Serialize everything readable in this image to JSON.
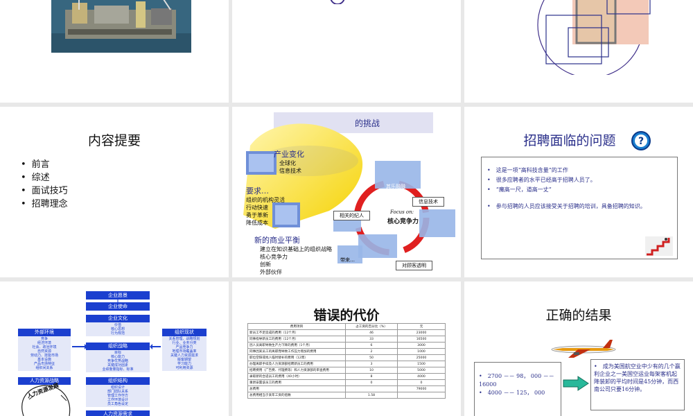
{
  "s2": {
    "title": "内容提要",
    "items": [
      "前言",
      "综述",
      "面试技巧",
      "招聘理念"
    ]
  },
  "s3": {
    "header": "的挑战",
    "h1": "产业变化",
    "l1": [
      "全球化",
      "信息技术"
    ],
    "h2": "要求…",
    "l2": [
      "组织的机构灵活",
      "行动快速",
      "勇于革新",
      "降低成本"
    ],
    "h3": "新的商业平衡",
    "l3": [
      "建立在知识基础上的组织战略",
      "核心竞争力",
      "创新",
      "外部伙伴"
    ],
    "focus_label": "Focus on:",
    "focus_text": "核心竞争力",
    "nodes": [
      "相关的纪人",
      "信息技术",
      "其乐融融",
      "带来…",
      "对顾客透明"
    ]
  },
  "s4": {
    "title": "招聘面临的问题",
    "items": [
      "这是一项“高科技含量”的工作",
      "很多应聘者的水平已经高于招聘人员了。",
      "“魔高一尺，道高一丈”",
      "参与招聘的人员应该接受关于招聘的培训，具备招聘的知识。"
    ]
  },
  "s5": {
    "top_boxes": [
      "企业愿景",
      "企业使命"
    ],
    "center": [
      {
        "head": "企业文化",
        "body": [
          "价值",
          "核心思想",
          "行为规范"
        ]
      },
      {
        "head": "组织战略",
        "body": [
          "目标",
          "核心能力",
          "竞争优势战略",
          "关键成功因素",
          "业绩衡量指标、标准"
        ]
      },
      {
        "head": "组织结构",
        "body": [
          "组织设计",
          "部门团队关系",
          "管理工作作方",
          "工作环境设计",
          "员工角色设定"
        ]
      },
      {
        "head": "人力资源需求",
        "body": []
      }
    ],
    "left": {
      "head": "外部环境",
      "body": [
        "竞争",
        "经济环境",
        "社会、政治环境",
        "自然资源",
        "劳动力、技能市场",
        "基本设施",
        "产品市场特征",
        "组织间关系"
      ]
    },
    "right": {
      "head": "组织现状",
      "body": [
        "关系管理、战略规划",
        "行业、业务分类",
        "产品竞争力",
        "地理市场覆盖率",
        "关键人力资源需求",
        "版客期望",
        "学习能力",
        "可利用资源"
      ]
    },
    "left2": "人力资源战略",
    "arc_text": "人力资源发展"
  },
  "s6": {
    "title": "错误的代价",
    "headers": [
      "费用项目",
      "占工资的百分比（%）",
      "元"
    ],
    "rows": [
      [
        "新员工不足造成的费用（12个月）",
        "46",
        "23000"
      ],
      [
        "同事指导新员工的费用（12个月）",
        "33",
        "16500"
      ],
      [
        "因人员离职导致生产力下降的费用（1个月）",
        "6",
        "3000"
      ],
      [
        "同事因某员工的离职而导致工作压力增加的费用",
        "2",
        "1000"
      ],
      [
        "职位空缺或找人临时替补的费用（12周）",
        "50",
        "25000"
      ],
      [
        "办理离职手续及人力资源部招聘新员工的费用",
        "3",
        "1500"
      ],
      [
        "招聘费用（广告费、代理费等）和人力资源部的审查费用",
        "10",
        "5000"
      ],
      [
        "录取新的合适员工的费用（40小时）",
        "8",
        "4000"
      ],
      [
        "重新安置该员工的费用",
        "0",
        "0"
      ],
      [
        "总费用",
        "",
        "79000"
      ]
    ],
    "footer_label": "总费用相当于某年工资的倍数",
    "footer_value": "1.58"
  },
  "s7": {
    "title": "正确的结果",
    "left_items": [
      "2700 －－ 98， 000 －－ 16000",
      "4000 －－ 125， 000"
    ],
    "right_text": "成为美国航空业中少有的几个赢利企业之一美国空运业每架客机起降装卸的平均时间是45分钟，而西南公司只要16分钟。"
  },
  "colors": {
    "slide_bg": "#ffffff",
    "page_bg": "#e8e8e8",
    "blue": "#1b3fcf",
    "navy": "#2a2f8a",
    "purple": "#40308a"
  }
}
